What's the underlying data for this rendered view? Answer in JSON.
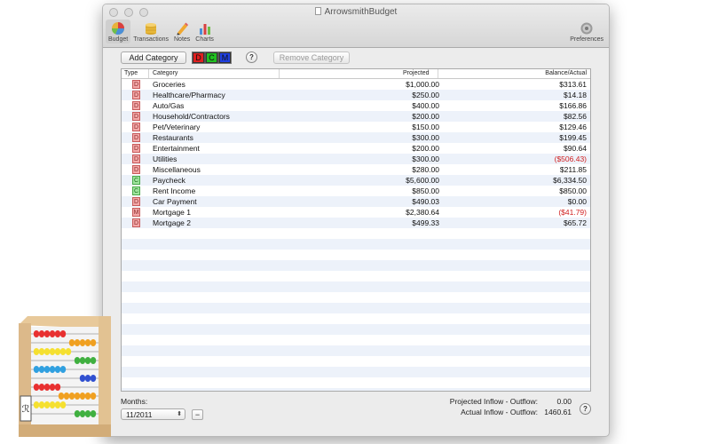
{
  "window": {
    "title": "ArrowsmithBudget"
  },
  "toolbar": {
    "items": [
      {
        "label": "Budget",
        "icon": "budget-pie-icon",
        "active": true
      },
      {
        "label": "Transactions",
        "icon": "coins-icon",
        "active": false
      },
      {
        "label": "Notes",
        "icon": "pencil-icon",
        "active": false
      },
      {
        "label": "Charts",
        "icon": "bar-chart-icon",
        "active": false
      }
    ],
    "preferences_label": "Preferences"
  },
  "actions": {
    "add_label": "Add Category",
    "type_buttons": [
      "D",
      "C",
      "M"
    ],
    "help": "?",
    "remove_label": "Remove Category"
  },
  "table": {
    "headers": {
      "type": "Type",
      "category": "Category",
      "projected": "Projected",
      "balance": "Balance/Actual"
    },
    "rows": [
      {
        "type": "D",
        "category": "Groceries",
        "projected": "$1,000.00",
        "balance": "$313.61",
        "negative": false
      },
      {
        "type": "D",
        "category": "Healthcare/Pharmacy",
        "projected": "$250.00",
        "balance": "$14.18",
        "negative": false
      },
      {
        "type": "D",
        "category": "Auto/Gas",
        "projected": "$400.00",
        "balance": "$166.86",
        "negative": false
      },
      {
        "type": "D",
        "category": "Household/Contractors",
        "projected": "$200.00",
        "balance": "$82.56",
        "negative": false
      },
      {
        "type": "D",
        "category": "Pet/Veterinary",
        "projected": "$150.00",
        "balance": "$129.46",
        "negative": false
      },
      {
        "type": "D",
        "category": "Restaurants",
        "projected": "$300.00",
        "balance": "$199.45",
        "negative": false
      },
      {
        "type": "D",
        "category": "Entertainment",
        "projected": "$200.00",
        "balance": "$90.64",
        "negative": false
      },
      {
        "type": "D",
        "category": "Utilities",
        "projected": "$300.00",
        "balance": "($506.43)",
        "negative": true
      },
      {
        "type": "D",
        "category": "Miscellaneous",
        "projected": "$280.00",
        "balance": "$211.85",
        "negative": false
      },
      {
        "type": "C",
        "category": "Paycheck",
        "projected": "$5,600.00",
        "balance": "$6,334.50",
        "negative": false
      },
      {
        "type": "C",
        "category": "Rent Income",
        "projected": "$850.00",
        "balance": "$850.00",
        "negative": false
      },
      {
        "type": "D",
        "category": "Car Payment",
        "projected": "$490.03",
        "balance": "$0.00",
        "negative": false
      },
      {
        "type": "M",
        "category": "Mortgage 1",
        "projected": "$2,380.64",
        "balance": "($41.79)",
        "negative": true
      },
      {
        "type": "D",
        "category": "Mortgage 2",
        "projected": "$499.33",
        "balance": "$65.72",
        "negative": false
      }
    ]
  },
  "footer": {
    "months_label": "Months:",
    "month_value": "11/2011",
    "minus_label": "−",
    "projected_label": "Projected Inflow - Outflow:",
    "projected_value": "0.00",
    "actual_label": "Actual Inflow - Outflow:",
    "actual_value": "1460.61",
    "help": "?"
  },
  "colors": {
    "debit": "#f3a8a8",
    "credit": "#9ee59e",
    "negative_text": "#d02020",
    "seg_D": "#e02020",
    "seg_C": "#20c020",
    "seg_M": "#2040e0"
  }
}
